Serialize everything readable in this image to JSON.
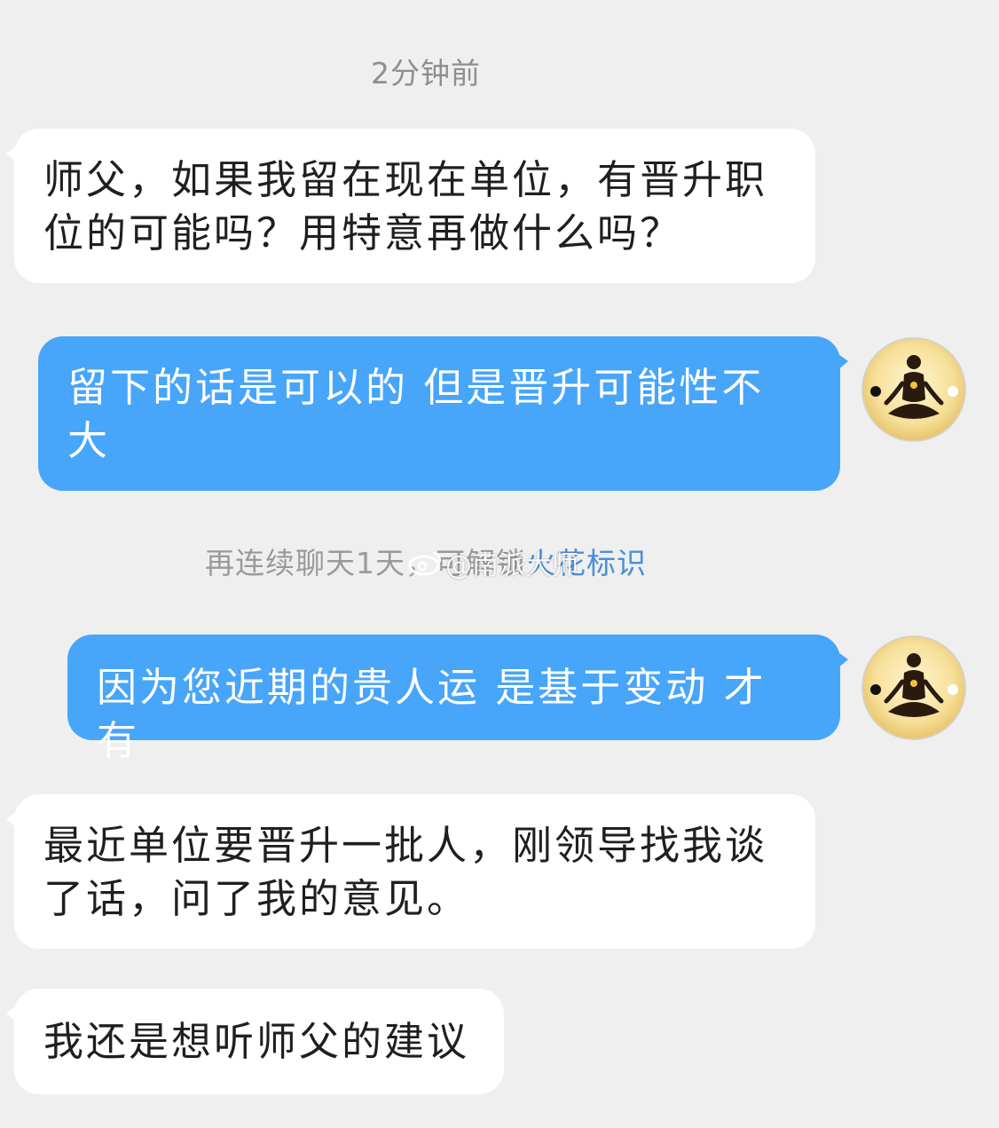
{
  "chat": {
    "timestamp": "2分钟前",
    "messages": [
      {
        "side": "incoming",
        "text": "师父，如果我留在现在单位，有晋升职位的可能吗？用特意再做什么吗？"
      },
      {
        "side": "outgoing",
        "text": "留下的话是可以的 但是晋升可能性不大"
      },
      {
        "side": "outgoing",
        "text": "因为您近期的贵人运 是基于变动 才有"
      },
      {
        "side": "incoming",
        "text": "最近单位要晋升一批人，刚领导找我谈了话，问了我的意见。"
      },
      {
        "side": "incoming",
        "text": "我还是想听师父的建议"
      }
    ],
    "system_tip": {
      "text": "再连续聊天1天，可解锁",
      "link": "火花标识"
    }
  },
  "watermark": {
    "text": "@南派大师"
  },
  "avatar": {
    "icon": "meditating-figure-icon"
  },
  "colors": {
    "background": "#efefef",
    "incoming_bubble": "#ffffff",
    "outgoing_bubble": "#47a5fa",
    "link": "#4a8fd6"
  }
}
